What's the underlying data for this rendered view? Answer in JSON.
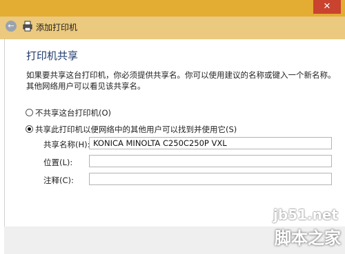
{
  "window": {
    "close_glyph": "✕"
  },
  "nav": {
    "title": "添加打印机"
  },
  "page": {
    "heading": "打印机共享",
    "description": "如果要共享这台打印机，你必须提供共享名。你可以使用建议的名称或键入一个新名称。其他网络用户可以看见该共享名。"
  },
  "options": {
    "no_share_label": "不共享这台打印机(O)",
    "share_label": "共享此打印机以便网络中的其他用户可以找到并使用它(S)",
    "selected": "share"
  },
  "fields": {
    "share_name_label": "共享名称(H):",
    "share_name_value": "KONICA MINOLTA C250C250P VXL",
    "location_label": "位置(L):",
    "location_value": "",
    "comment_label": "注释(C):",
    "comment_value": ""
  },
  "watermark": {
    "site": "jb51.net",
    "name": "脚本之家"
  }
}
